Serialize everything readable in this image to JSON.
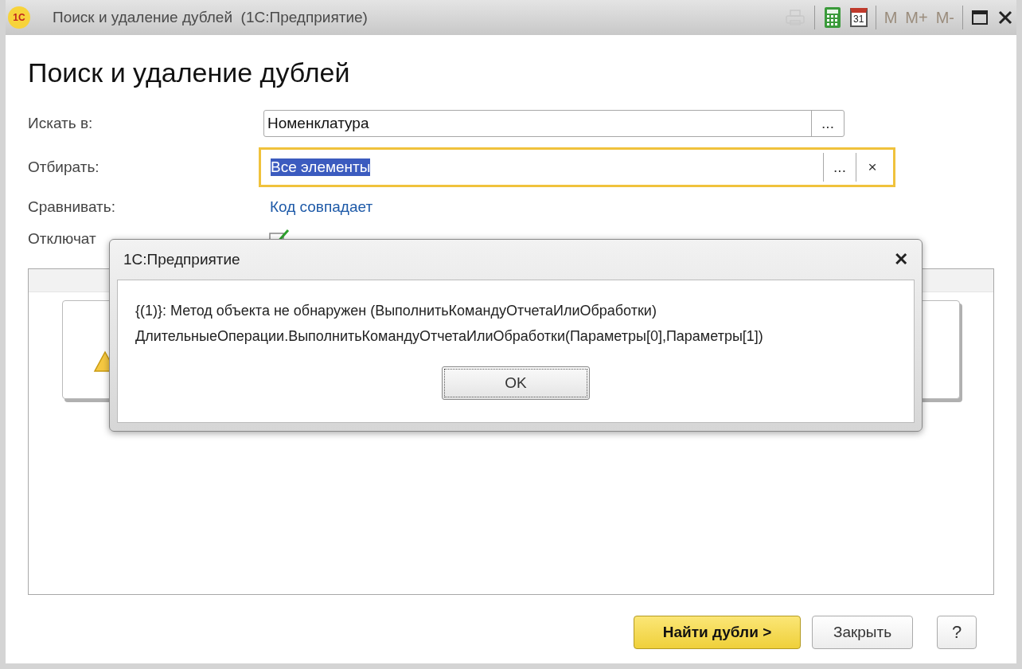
{
  "window": {
    "logo": "1С",
    "title": "Поиск и удаление дублей  (1С:Предприятие)",
    "toolbar": [
      {
        "kind": "print",
        "disabled": true
      },
      {
        "kind": "calculator",
        "disabled": false
      },
      {
        "kind": "calendar",
        "text": "31",
        "disabled": false
      },
      {
        "kind": "memory",
        "text": "M",
        "disabled": true
      },
      {
        "kind": "memory",
        "text": "M+",
        "disabled": true
      },
      {
        "kind": "memory",
        "text": "M-",
        "disabled": true
      },
      {
        "kind": "maximize",
        "disabled": false
      },
      {
        "kind": "close",
        "disabled": false
      }
    ]
  },
  "heading": "Поиск и удаление дублей",
  "rows": [
    {
      "label": "Искать в:",
      "kind": "select",
      "value": "Номенклатура",
      "focused": false,
      "text_selected": false,
      "choose_button": "..."
    },
    {
      "label": "Отбирать:",
      "kind": "select",
      "value": "Все элементы",
      "focused": true,
      "text_selected": true,
      "choose_button": "...",
      "clear_button": "×"
    },
    {
      "label": "Сравнивать:",
      "kind": "link",
      "value": "Код совпадает"
    },
    {
      "label": "Отключат",
      "kind": "checkbox",
      "checked": true
    }
  ],
  "dialog": {
    "title": "1С:Предприятие",
    "close": "✕",
    "lines": [
      "{(1)}: Метод объекта не обнаружен (ВыполнитьКомандуОтчетаИлиОбработки)",
      "ДлительныеОперации.ВыполнитьКомандуОтчетаИлиОбработки(Параметры[0],Параметры[1])"
    ],
    "button": "OK"
  },
  "buttons": [
    {
      "label": "Найти дубли >",
      "kind": "primary"
    },
    {
      "label": "Закрыть",
      "kind": "normal"
    },
    {
      "label": "?",
      "kind": "help"
    }
  ]
}
